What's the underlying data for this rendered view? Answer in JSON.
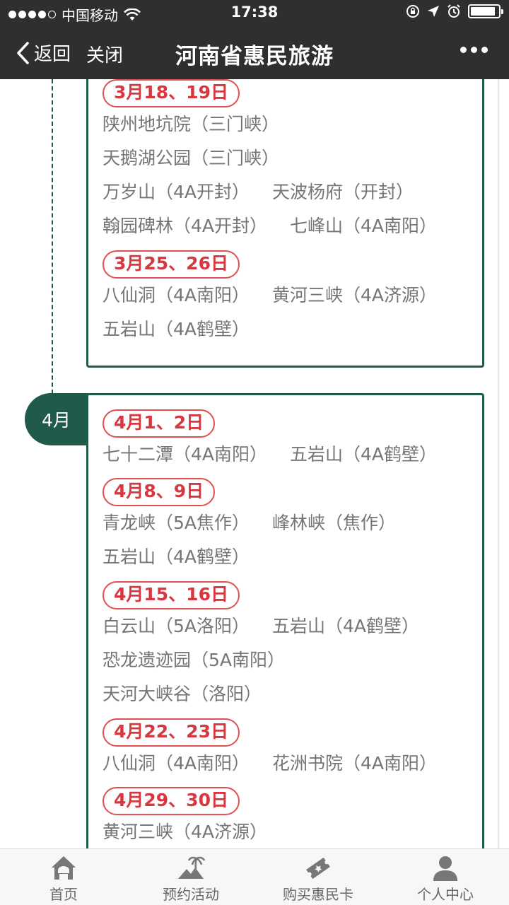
{
  "status": {
    "carrier": "中国移动",
    "time": "17:38"
  },
  "nav": {
    "back_label": "返回",
    "close_label": "关闭",
    "title": "河南省惠民旅游"
  },
  "march_entries": [
    {
      "date": "3月18、19日",
      "lines": [
        [
          "陕州地坑院（三门峡）"
        ],
        [
          "天鹅湖公园（三门峡）"
        ],
        [
          "万岁山（4A开封）",
          "天波杨府（开封）"
        ],
        [
          "翰园碑林（4A开封）",
          "七峰山（4A南阳）"
        ]
      ]
    },
    {
      "date": "3月25、26日",
      "lines": [
        [
          "八仙洞（4A南阳）",
          "黄河三峡（4A济源）"
        ],
        [
          "五岩山（4A鹤壁）"
        ]
      ]
    }
  ],
  "april": {
    "month_label": "4月",
    "entries": [
      {
        "date": "4月1、2日",
        "lines": [
          [
            "七十二潭（4A南阳）",
            "五岩山（4A鹤壁）"
          ]
        ]
      },
      {
        "date": "4月8、9日",
        "lines": [
          [
            "青龙峡（5A焦作）",
            "峰林峡（焦作）"
          ],
          [
            "五岩山（4A鹤壁）"
          ]
        ]
      },
      {
        "date": "4月15、16日",
        "lines": [
          [
            "白云山（5A洛阳）",
            "五岩山（4A鹤壁）"
          ],
          [
            "恐龙遗迹园（5A南阳）"
          ],
          [
            "天河大峡谷（洛阳）"
          ]
        ]
      },
      {
        "date": "4月22、23日",
        "lines": [
          [
            "八仙洞（4A南阳）",
            "花洲书院（4A南阳）"
          ]
        ]
      },
      {
        "date": "4月29、30日",
        "lines": [
          [
            "黄河三峡（4A济源）"
          ]
        ]
      }
    ]
  },
  "tabs": [
    {
      "label": "首页",
      "icon": "home-icon"
    },
    {
      "label": "预约活动",
      "icon": "palm-beach-icon"
    },
    {
      "label": "购买惠民卡",
      "icon": "ticket-icon"
    },
    {
      "label": "个人中心",
      "icon": "user-icon"
    }
  ],
  "colors": {
    "bar_bg": "#2f2f31",
    "accent_green": "#1f5a4a",
    "date_red": "#d7373f",
    "text_gray": "#757575"
  },
  "battery_level": 0.9
}
